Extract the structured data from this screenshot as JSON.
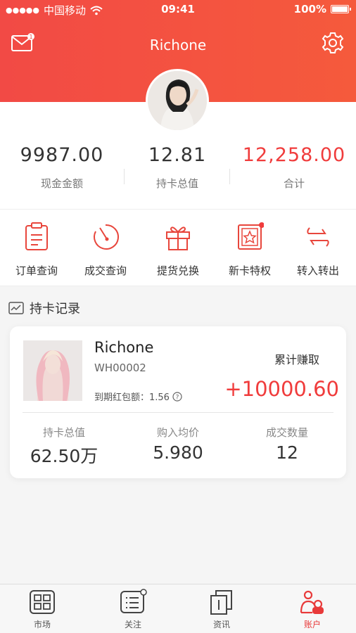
{
  "status_bar": {
    "carrier": "中国移动",
    "time": "09:41",
    "battery": "100%"
  },
  "header": {
    "title": "Richone",
    "mail_badge": "1"
  },
  "stats": [
    {
      "value": "9987.00",
      "label": "现金金额"
    },
    {
      "value": "12.81",
      "label": "持卡总值"
    },
    {
      "value": "12,258.00",
      "label": "合计"
    }
  ],
  "actions": [
    {
      "label": "订单查询",
      "icon": "clipboard-icon"
    },
    {
      "label": "成交查询",
      "icon": "gauge-icon"
    },
    {
      "label": "提货兑换",
      "icon": "gift-icon"
    },
    {
      "label": "新卡特权",
      "icon": "star-card-icon"
    },
    {
      "label": "转入转出",
      "icon": "transfer-icon"
    }
  ],
  "section": {
    "title": "持卡记录"
  },
  "card": {
    "name": "Richone",
    "code": "WH00002",
    "expire_label": "到期红包额：1.56",
    "earn_label": "累计赚取",
    "earn_value": "+10000.60",
    "stats": [
      {
        "label": "持卡总值",
        "value": "62.50万"
      },
      {
        "label": "购入均价",
        "value": "5.980"
      },
      {
        "label": "成交数量",
        "value": "12"
      }
    ]
  },
  "tabbar": [
    {
      "label": "市场"
    },
    {
      "label": "关注"
    },
    {
      "label": "资讯"
    },
    {
      "label": "账户"
    }
  ],
  "colors": {
    "accent": "#f24a45",
    "red_text": "#f03c3c"
  }
}
